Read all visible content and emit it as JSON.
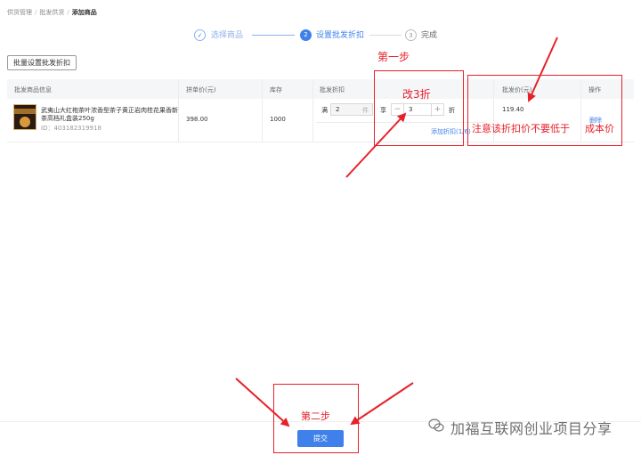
{
  "breadcrumb": [
    "供货管理",
    "批发供货",
    "添加商品"
  ],
  "steps": [
    {
      "num": "1",
      "label": "选择商品",
      "state": "done"
    },
    {
      "num": "2",
      "label": "设置批发折扣",
      "state": "active"
    },
    {
      "num": "3",
      "label": "完成",
      "state": "pending"
    }
  ],
  "batch_button": "批量设置批发折扣",
  "table": {
    "headers": [
      "批发商品信息",
      "拼单价(元)",
      "库存",
      "批发折扣",
      "批发价(元)",
      "操作"
    ],
    "row": {
      "name": "武夷山大红袍茶叶浓香型茶子黄正岩肉桂花果香新茶高档礼盒装250g",
      "id": "ID：403182319918",
      "price": "398.00",
      "stock": "1000",
      "discount": {
        "prefix": "满",
        "qty": "2",
        "qty_unit": "件",
        "enjoy": "享",
        "value": "3",
        "unit": "折",
        "minus": "−",
        "plus": "+"
      },
      "add_discount": "添加折扣(1/6)",
      "wholesale_price": "119.40",
      "action": "删除"
    }
  },
  "annotations": {
    "step1": "第一步",
    "change": "改3折",
    "note": "注意该折扣价不要低于",
    "cost": "成本价",
    "step2": "第二步"
  },
  "submit_button": "提交",
  "watermark": "加福互联网创业项目分享",
  "colors": {
    "accent": "#3f80ea",
    "annotation": "#e8202a"
  }
}
